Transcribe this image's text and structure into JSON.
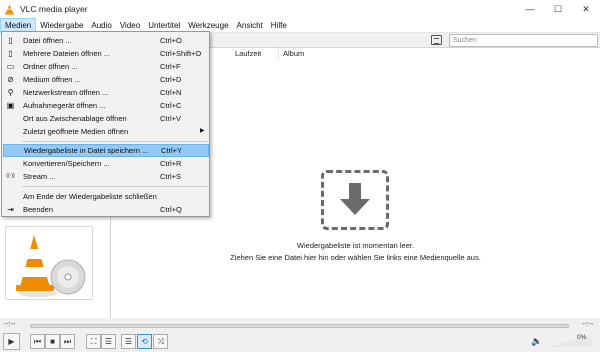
{
  "window": {
    "title": "VLC media player",
    "minimize": "—",
    "maximize": "☐",
    "close": "✕"
  },
  "menubar": [
    "Medien",
    "Wiedergabe",
    "Audio",
    "Video",
    "Untertitel",
    "Werkzeuge",
    "Ansicht",
    "Hilfe"
  ],
  "media_menu": {
    "items": [
      {
        "icon": "file-icon",
        "glyph": "▯",
        "label": "Datei öffnen ...",
        "shortcut": "Ctrl+O"
      },
      {
        "icon": "files-icon",
        "glyph": "▯",
        "label": "Mehrere Dateien öffnen ...",
        "shortcut": "Ctrl+Shift+O"
      },
      {
        "icon": "folder-icon",
        "glyph": "▭",
        "label": "Ordner öffnen ...",
        "shortcut": "Ctrl+F"
      },
      {
        "icon": "disc-icon",
        "glyph": "⊘",
        "label": "Medium öffnen ...",
        "shortcut": "Ctrl+D"
      },
      {
        "icon": "network-icon",
        "glyph": "⚲",
        "label": "Netzwerkstream öffnen ...",
        "shortcut": "Ctrl+N"
      },
      {
        "icon": "capture-device-icon",
        "glyph": "▣",
        "label": "Aufnahmegerät öffnen ...",
        "shortcut": "Ctrl+C"
      },
      {
        "icon": "",
        "glyph": "",
        "label": "Ort aus Zwischenablage öffnen",
        "shortcut": "Ctrl+V"
      },
      {
        "icon": "",
        "glyph": "",
        "label": "Zuletzt geöffnete Medien öffnen",
        "shortcut": "",
        "submenu": true
      },
      {
        "icon": "",
        "glyph": "",
        "label": "Wiedergabeliste in Datei speichern ...",
        "shortcut": "Ctrl+Y",
        "highlighted": true
      },
      {
        "icon": "",
        "glyph": "",
        "label": "Konvertieren/Speichern ...",
        "shortcut": "Ctrl+R"
      },
      {
        "icon": "stream-icon",
        "glyph": "((·))",
        "label": "Stream ...",
        "shortcut": "Ctrl+S"
      },
      {
        "icon": "",
        "glyph": "",
        "label": "Am Ende der Wiedergabeliste schließen",
        "shortcut": ""
      },
      {
        "icon": "quit-icon",
        "glyph": "⇥",
        "label": "Beenden",
        "shortcut": "Ctrl+Q"
      }
    ],
    "submenu_arrow": "▶"
  },
  "playlist": {
    "search_placeholder": "Suchen",
    "columns": [
      "Laufzeit",
      "Album"
    ],
    "empty_line1": "Wiedergabeliste ist momentan leer.",
    "empty_line2": "Ziehen Sie eine Datei hier hin oder wählen Sie links eine Medienquelle aus."
  },
  "seekbar": {
    "elapsed": "--:--",
    "remaining": "--:--"
  },
  "controls": {
    "play": "▶",
    "prev": "⏮",
    "stop": "■",
    "next": "⏭",
    "fullscreen": "⛶",
    "extended": "☰",
    "playlist": "☰",
    "loop": "⟲",
    "shuffle": "⤨",
    "speaker": "🔈",
    "volume": "0%"
  },
  "colors": {
    "menu_highlight": "#91c9f7",
    "active_menu": "#cce8ff",
    "vlc_orange": "#f08c00"
  }
}
